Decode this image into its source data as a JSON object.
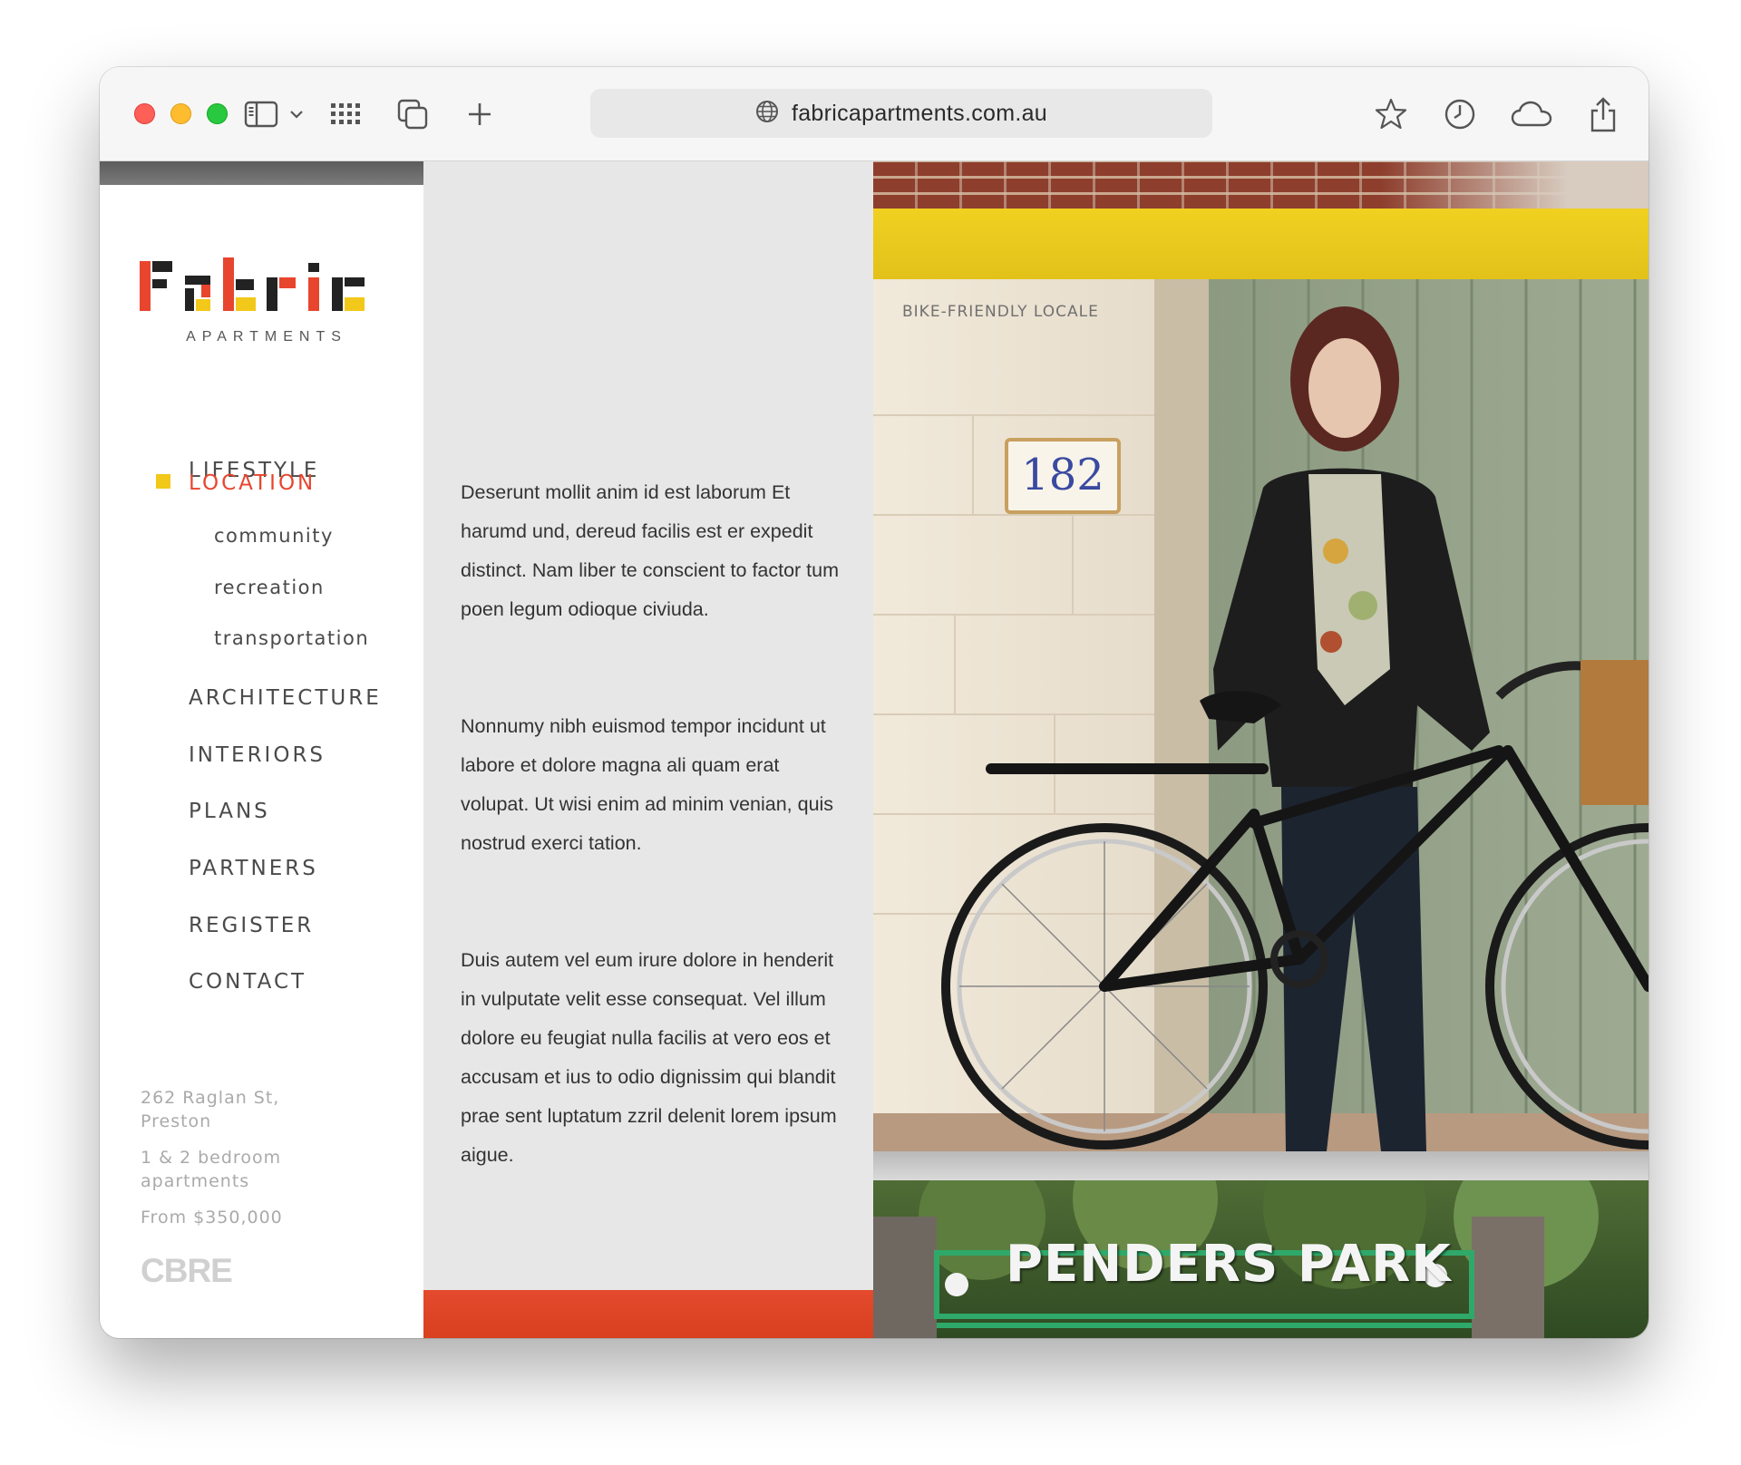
{
  "browser": {
    "url": "fabricapartments.com.au"
  },
  "logo": {
    "name": "Fabric",
    "subtitle": "APARTMENTS"
  },
  "nav": {
    "items": [
      {
        "label": "LIFESTYLE"
      },
      {
        "label": "LOCATION"
      },
      {
        "label": "ARCHITECTURE"
      },
      {
        "label": "INTERIORS"
      },
      {
        "label": "PLANS"
      },
      {
        "label": "PARTNERS"
      },
      {
        "label": "REGISTER"
      },
      {
        "label": "CONTACT"
      }
    ],
    "sub_items": [
      {
        "label": "community"
      },
      {
        "label": "recreation"
      },
      {
        "label": "transportation"
      }
    ]
  },
  "info": {
    "address": "262 Raglan St, Preston",
    "apartments": "1 & 2 bedroom apartments",
    "price": "From $350,000",
    "agent": "CBRE"
  },
  "content": {
    "paragraphs": [
      "Deserunt mollit anim id est laborum Et harumd und, dereud facilis est er expedit distinct. Nam liber te conscient to factor tum poen legum odioque civiuda.",
      "Nonnumy nibh euismod tempor incidunt ut labore et dolore magna ali quam erat volupat. Ut wisi enim ad minim venian, quis nostrud exerci tation.",
      "Duis autem vel eum irure dolore in henderit in vulputate velit esse consequat. Vel illum dolore eu feugiat nulla facilis at vero eos et accusam et ius to odio dignissim qui blandit prae sent luptatum zzril delenit lorem ipsum aigue."
    ]
  },
  "photo": {
    "caption": "BIKE-FRIENDLY LOCALE",
    "house_number": "182"
  },
  "park": {
    "sign": "PENDERS PARK"
  },
  "colors": {
    "accent_red": "#e8452e",
    "accent_yellow": "#f2c81a"
  }
}
